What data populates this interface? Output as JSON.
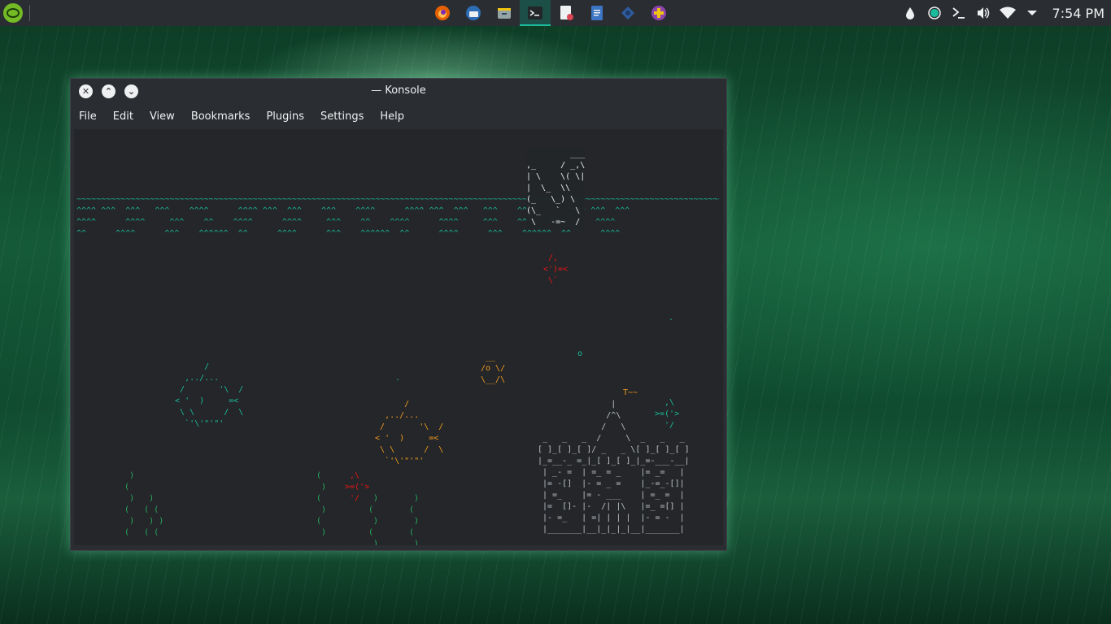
{
  "panel": {
    "menu_icon": "opensuse-icon",
    "taskbar": [
      {
        "name": "firefox-icon",
        "color": "#e66000"
      },
      {
        "name": "thunderbird-icon",
        "color": "#2d6db5"
      },
      {
        "name": "file-manager-icon",
        "color": "#7f8c8d"
      },
      {
        "name": "konsole-icon",
        "color": "#232629",
        "active": true
      },
      {
        "name": "document-viewer-icon",
        "color": "#eff0f1"
      },
      {
        "name": "writer-icon",
        "color": "#3b75c3"
      },
      {
        "name": "kde-connect-icon",
        "color": "#2f5a9c"
      },
      {
        "name": "first-aid-icon",
        "color": "#8e44ad"
      }
    ],
    "tray": {
      "clock": "7:54 PM",
      "icons": [
        "droplet-icon",
        "status-circle-icon",
        "terminal-icon",
        "volume-icon",
        "wifi-icon",
        "expand-arrow-icon"
      ]
    }
  },
  "window": {
    "title": "— Konsole",
    "buttons": {
      "close": "✕",
      "up": "⌃",
      "down": "⌄"
    },
    "menu": [
      "File",
      "Edit",
      "View",
      "Bookmarks",
      "Plugins",
      "Settings",
      "Help"
    ]
  },
  "terminal": {
    "waves": "~~~~~~~~~~~~~~~~~~~~~~~~~~~~~~~~~~~~~~~~~~~~~~~~~~~~~~~~~~~~~~~~~~~~~~~~~~~~~~~~~~~~~~~~~~~~~~~~~~~~~~~~~~~~~~~~~~~~~~~~~~~~~~~~~~~~~~~~~~~~\n^^^^ ^^^  ^^^   ^^^    ^^^^      ^^^^ ^^^  ^^^    ^^^    ^^^^      ^^^^ ^^^  ^^^   ^^^    ^^^^      ^^^^ ^^^  ^^^\n^^^^      ^^^^     ^^^    ^^    ^^^^      ^^^^     ^^^    ^^    ^^^^      ^^^^     ^^^    ^^    ^^^^      ^^^^\n^^      ^^^^      ^^^    ^^^^^^  ^^      ^^^^      ^^^    ^^^^^^  ^^      ^^^^      ^^^    ^^^^^^  ^^      ^^^^",
    "ship": "         ___\n,_     / _,\\\n| \\    \\( \\|\n|  \\_  \\\\\n(_   \\_) \\\n(\\_   `   \\\n \\   -=~  /",
    "fish_small_top": " /,\n<')=<\n \\`",
    "bubble1": ".",
    "bubble2": "o",
    "bubble3": ".",
    "crab": " __\n/o \\/\n\\__/\\",
    "fish_big_left": "        /\n    ,../...\n   /       '\\  /\n  < '  )     =<\n   \\ \\      /  \\\n    `'\\'\"'\"'",
    "fish_big_mid": "        /\n    ,../...\n   /       '\\  /\n  < '  )     =<\n   \\ \\      /  \\\n    `'\\'\"'\"'",
    "fish_small_right": "  ,\\\n>=('>\n  '/",
    "fish_small_bottom": " ,\\\n>=('>\n '/",
    "seaweed_left": "    )\n   (\n    )   )\n   (   ( (\n    )   ) )\n   (   ( (",
    "seaweed_mid": "(\n )\n(\n )\n(\n )",
    "seaweed_right": "   )\n  (\n   )\n  (\n   )\n  (",
    "seaweed_far": " )\n(\n )\n(\n )\n(",
    "castle_flag": "T~~",
    "castle": "               |\n              /^\\\n             /   \\\n _   _   _  /     \\  _   _   _\n[ ]_[ ]_[ ]/ _   _ \\[ ]_[ ]_[ ]\n|_=__-_ =_|_[ ]_[ ]_|_=-___-__|\n | _- =  | =_ = _    |= _=   |\n |= -[]  |- = _ =    |_-=_-[]|\n | =_    |= - ___    | =_ =  |\n |=  []- |-  /| |\\   |=_ =[] |\n |- =_   | =| | | |  |- = -  |\n |_______|__|_|_|_|__|_______|"
  }
}
